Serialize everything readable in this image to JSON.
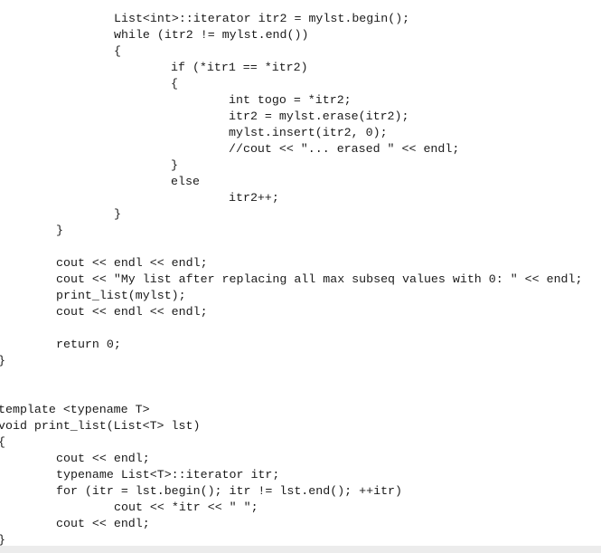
{
  "editor": {
    "lines": [
      {
        "indent": 2,
        "text": "List<int>::iterator itr2 = mylst.begin();"
      },
      {
        "indent": 2,
        "text": "while (itr2 != mylst.end())"
      },
      {
        "indent": 2,
        "text": "{"
      },
      {
        "indent": 3,
        "text": "if (*itr1 == *itr2)"
      },
      {
        "indent": 3,
        "text": "{"
      },
      {
        "indent": 4,
        "text": "int togo = *itr2;"
      },
      {
        "indent": 4,
        "text": "itr2 = mylst.erase(itr2);"
      },
      {
        "indent": 4,
        "text": "mylst.insert(itr2, 0);"
      },
      {
        "indent": 4,
        "text": "//cout << \"... erased \" << endl;"
      },
      {
        "indent": 3,
        "text": "}"
      },
      {
        "indent": 3,
        "text": "else"
      },
      {
        "indent": 4,
        "text": "itr2++;"
      },
      {
        "indent": 2,
        "text": "}"
      },
      {
        "indent": 1,
        "text": "}"
      },
      {
        "indent": 0,
        "text": ""
      },
      {
        "indent": 1,
        "text": "cout << endl << endl;"
      },
      {
        "indent": 1,
        "text": "cout << \"My list after replacing all max subseq values with 0: \" << endl;"
      },
      {
        "indent": 1,
        "text": "print_list(mylst);"
      },
      {
        "indent": 1,
        "text": "cout << endl << endl;"
      },
      {
        "indent": 0,
        "text": ""
      },
      {
        "indent": 1,
        "text": "return 0;"
      },
      {
        "indent": 0,
        "text": "}"
      },
      {
        "indent": 0,
        "text": ""
      },
      {
        "indent": 0,
        "text": ""
      },
      {
        "indent": 0,
        "text": "template <typename T>"
      },
      {
        "indent": 0,
        "text": "void print_list(List<T> lst)"
      },
      {
        "indent": 0,
        "text": "{"
      },
      {
        "indent": 1,
        "text": "cout << endl;"
      },
      {
        "indent": 1,
        "text": "typename List<T>::iterator itr;"
      },
      {
        "indent": 1,
        "text": "for (itr = lst.begin(); itr != lst.end(); ++itr)"
      },
      {
        "indent": 2,
        "text": "cout << *itr << \" \";"
      },
      {
        "indent": 1,
        "text": "cout << endl;"
      },
      {
        "indent": 0,
        "text": "}"
      }
    ]
  }
}
